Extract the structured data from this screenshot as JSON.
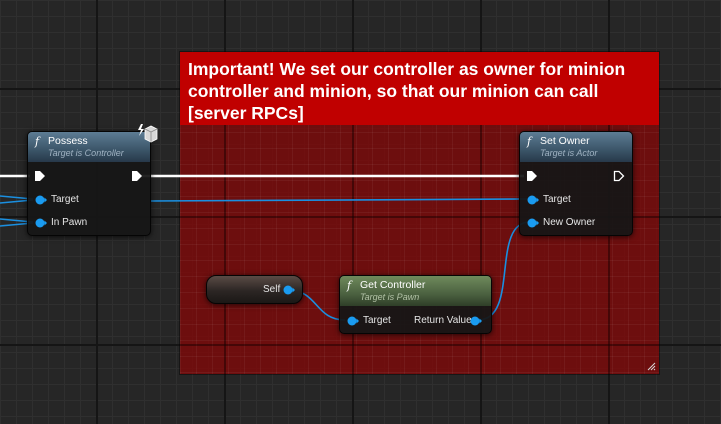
{
  "comment": {
    "text": "Important! We set our controller as owner for minion controller and minion, so that our minion can call [server RPCs]"
  },
  "nodes": {
    "possess": {
      "glyph": "f",
      "title": "Possess",
      "subtitle": "Target is Controller",
      "pins": [
        "Target",
        "In Pawn"
      ],
      "icon": "server-only-icon"
    },
    "set_owner": {
      "glyph": "f",
      "title": "Set Owner",
      "subtitle": "Target is Actor",
      "pins": [
        "Target",
        "New Owner"
      ]
    },
    "get_controller": {
      "glyph": "f",
      "title": "Get Controller",
      "subtitle": "Target is Pawn",
      "input_pin": "Target",
      "output_pin": "Return Value"
    },
    "self": {
      "label": "Self"
    }
  },
  "colors": {
    "comment_body": "#820808",
    "comment_header": "#c00000",
    "function_header": "#3b5568",
    "pure_header": "#4b6140",
    "object_pin": "#1a9bf0",
    "exec_wire": "#ffffff"
  }
}
